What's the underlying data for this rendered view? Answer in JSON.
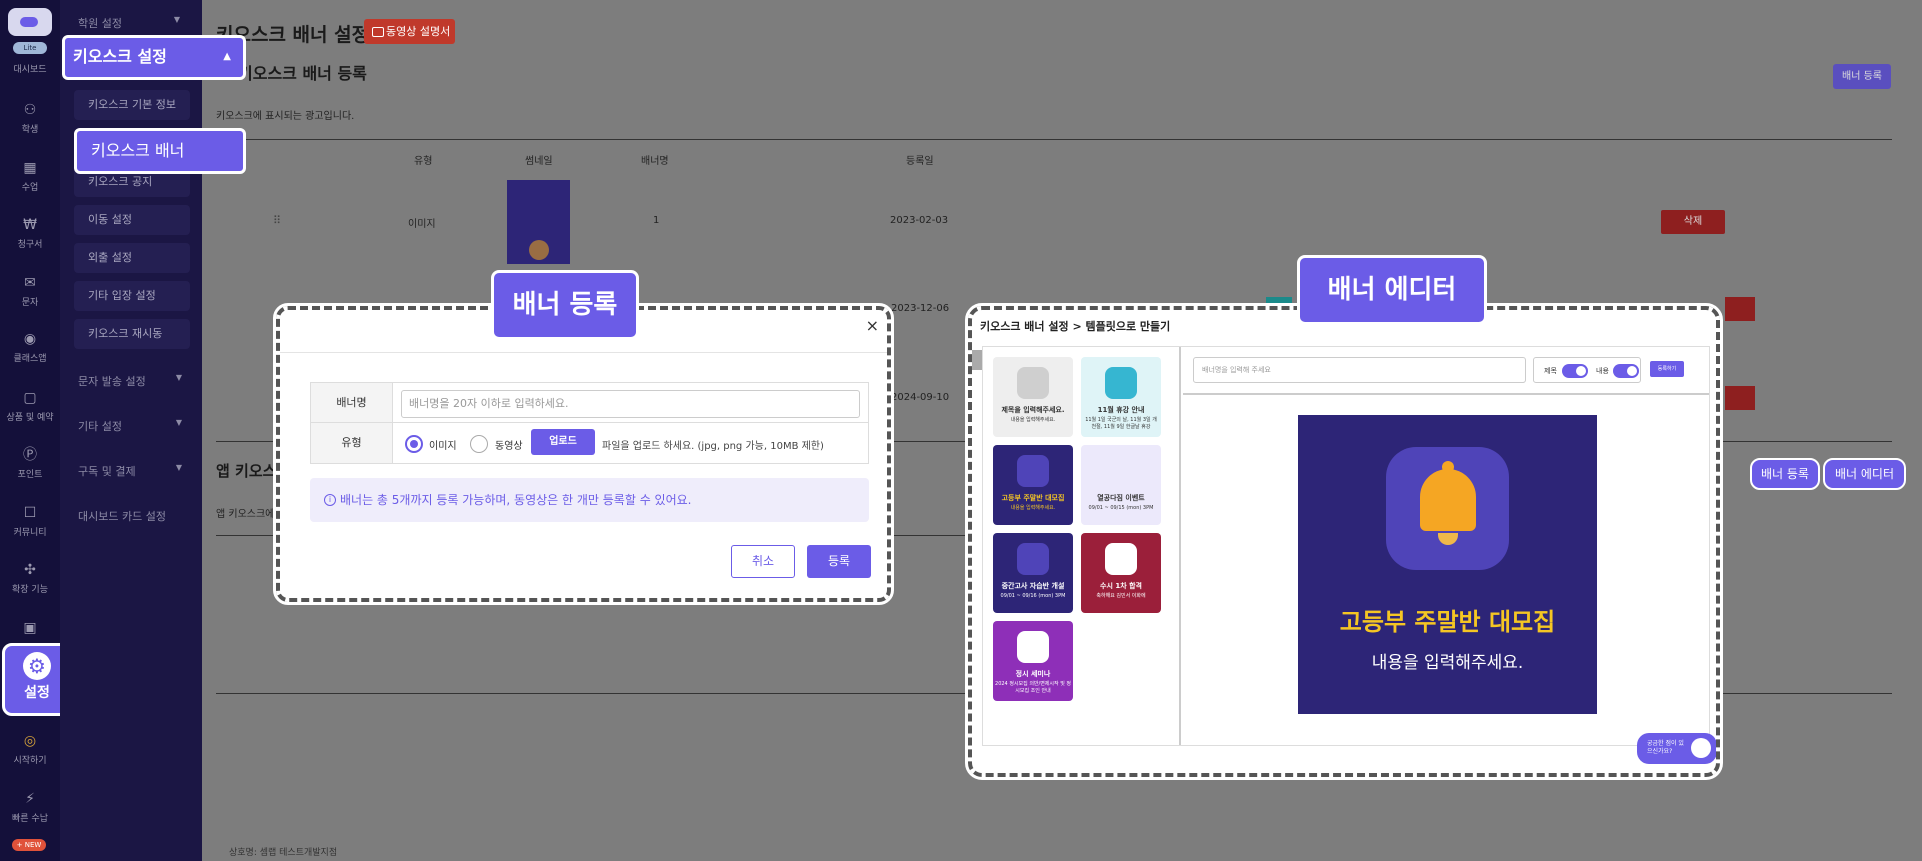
{
  "rail": {
    "lite_badge": "Lite",
    "items": [
      {
        "label": "대시보드",
        "icon": "dashboard-icon"
      },
      {
        "label": "학생",
        "icon": "students-icon"
      },
      {
        "label": "수업",
        "icon": "calendar-icon"
      },
      {
        "label": "청구서",
        "icon": "won-icon"
      },
      {
        "label": "문자",
        "icon": "mail-icon"
      },
      {
        "label": "클래스앱",
        "icon": "pin-icon"
      },
      {
        "label": "상품 및 예약",
        "icon": "bag-icon"
      },
      {
        "label": "포인트",
        "icon": "point-icon"
      },
      {
        "label": "커뮤니티",
        "icon": "chat-icon"
      },
      {
        "label": "확장 기능",
        "icon": "puzzle-icon"
      },
      {
        "label": "시작하기",
        "icon": "start-icon"
      },
      {
        "label": "빠른 수납",
        "icon": "bolt-icon"
      }
    ],
    "active_label": "설정",
    "new_badge": "+ NEW"
  },
  "submenu": {
    "top_group": "학원 설정",
    "kiosk_group": "키오스크 설정",
    "kiosk_items": [
      "키오스크 기본 정보",
      "키오스크 배너",
      "키오스크 공지",
      "이동 설정",
      "외출 설정",
      "기타 입장 설정",
      "키오스크 재시동"
    ],
    "groups_below": [
      "문자 발송 설정",
      "기타 설정",
      "구독 및 결제",
      "대시보드 카드 설정"
    ]
  },
  "main": {
    "title": "키오스크 배너 설정",
    "video_button": "동영상 설명서",
    "section_title": "키오스크 배너 등록",
    "section_note": "키오스크에 표시되는 광고입니다.",
    "register_button": "배너 등록",
    "columns": [
      "유형",
      "썸네일",
      "배너명",
      "등록일"
    ],
    "rows": [
      {
        "type": "이미지",
        "name": "1",
        "date": "2023-02-03",
        "delete": "삭제"
      },
      {
        "date": "2023-12-06"
      },
      {
        "date": "2024-09-10"
      }
    ],
    "app_section": "앱 키오스",
    "app_note": "앱 키오스크에",
    "footer": "상호명: 셈랩 테스트개발지점"
  },
  "modal": {
    "callout": "배너 등록",
    "name_label": "배너명",
    "name_placeholder": "배너명을 20자 이하로 입력하세요.",
    "type_label": "유형",
    "type_options": [
      "이미지",
      "동영상"
    ],
    "upload_button": "업로드",
    "upload_hint": "파일을 업로드 하세요. (jpg, png 가능, 10MB 제한)",
    "info": "배너는 총 5개까지 등록 가능하며, 동영상은 한 개만 등록할 수 있어요.",
    "cancel": "취소",
    "submit": "등록"
  },
  "editor": {
    "callout": "배너 에디터",
    "title": "키오스크 배너 설정 > 템플릿으로 만들기",
    "templates": [
      {
        "title": "제목을 입력해주세요.",
        "sub": "내용을 입력해주세요.",
        "bg": "#eeeeee",
        "fg": "#333333",
        "icon_bg": "#cfcfcf"
      },
      {
        "title": "11월 휴강 안내",
        "sub": "11월 1일 국군의 날, 11월 3일 개천절, 11월 9일 한글날 휴강",
        "bg": "#dff4f7",
        "fg": "#333333",
        "icon_bg": "#36b6d1"
      },
      {
        "title": "고등부 주말반 대모집",
        "sub": "내용을 입력해주세요.",
        "bg": "#2d2577",
        "fg": "#f5c623",
        "icon_bg": "#4f44b8"
      },
      {
        "title": "열공다짐 이벤트",
        "sub": "09/01 ~ 09/15 (mon) 3PM",
        "bg": "#ece9fb",
        "fg": "#333333",
        "icon_bg": "#ece9fb"
      },
      {
        "title": "중간고사 자습반 개설",
        "sub": "09/01 ~ 09/16 (mon) 3PM",
        "bg": "#2d2577",
        "fg": "#ffffff",
        "icon_bg": "#4f44b8"
      },
      {
        "title": "수시 1차 합격",
        "sub": "축하해요 김민서 이화에",
        "bg": "#9b1f3a",
        "fg": "#ffffff",
        "icon_bg": "#ffffff"
      },
      {
        "title": "정시 세미나",
        "sub": "2024 정시모집 의반/면제시작 및 정시모집 조인 안내",
        "bg": "#8e2fb8",
        "fg": "#ffffff",
        "icon_bg": "#ffffff"
      }
    ],
    "input_placeholder": "배너명을 입력해 주세요",
    "toggle_title": "제목",
    "toggle_content": "내용",
    "register_small": "등록하기",
    "preview_title": "고등부 주말반 대모집",
    "preview_sub": "내용을 입력해주세요.",
    "chat_text": "궁금한 점이 있으신가요?"
  },
  "side_buttons": {
    "register": "배너 등록",
    "editor": "배너 에디터"
  },
  "colors": {
    "accent": "#6b5ce7",
    "danger": "#c0392b",
    "rail": "#14103a"
  }
}
